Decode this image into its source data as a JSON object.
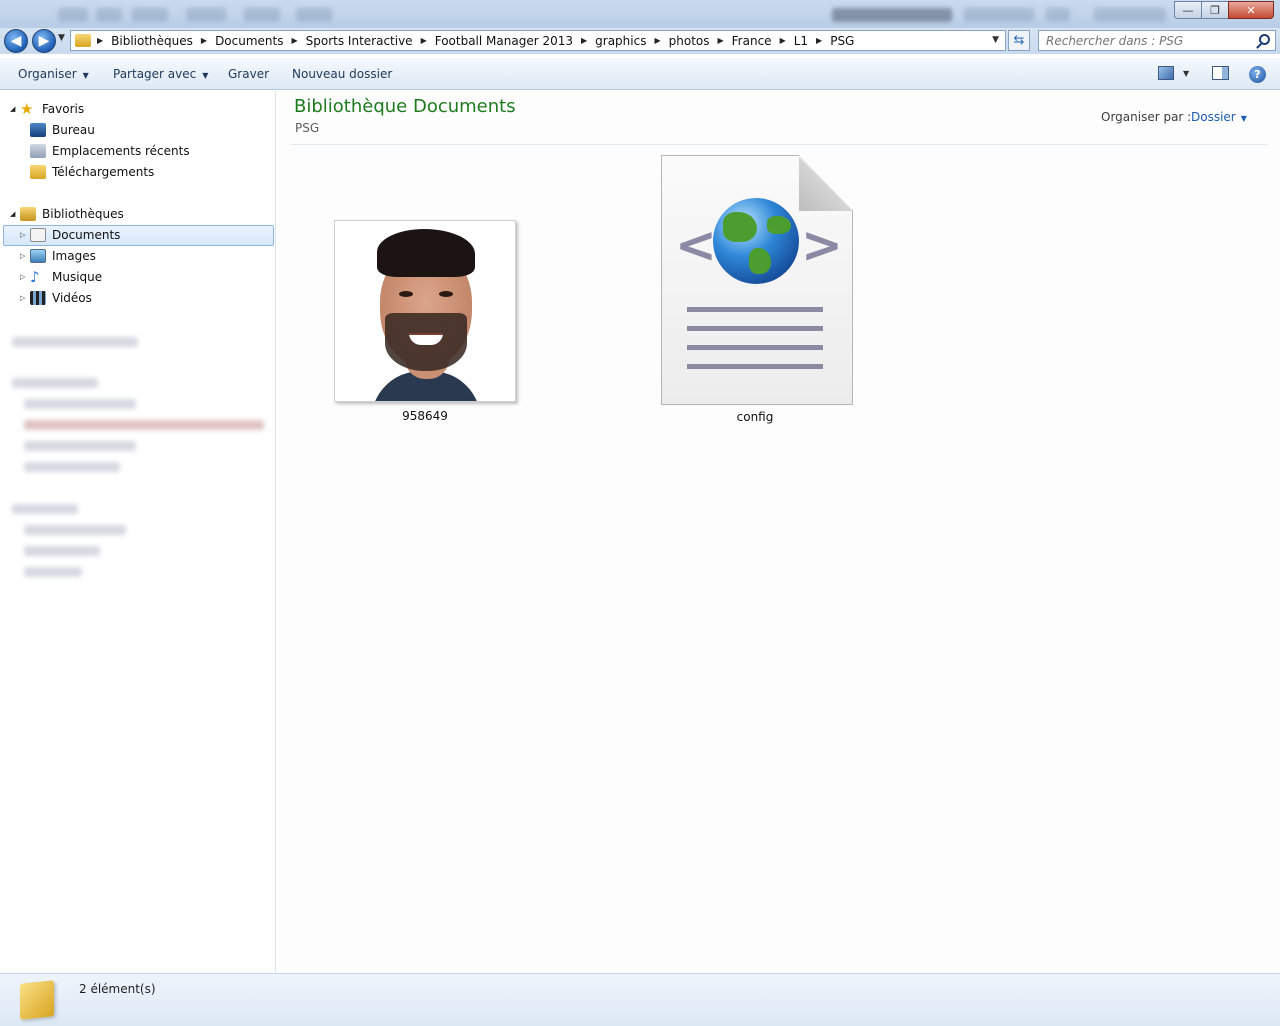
{
  "window": {
    "controls": {
      "minimize": "—",
      "maximize": "❐",
      "close": "✕"
    }
  },
  "address": {
    "back": "◀",
    "forward": "▶",
    "crumbs": [
      "Bibliothèques",
      "Documents",
      "Sports Interactive",
      "Football Manager 2013",
      "graphics",
      "photos",
      "France",
      "L1",
      "PSG"
    ],
    "search_placeholder": "Rechercher dans : PSG"
  },
  "toolbar": {
    "organize": "Organiser",
    "share": "Partager avec",
    "burn": "Graver",
    "new_folder": "Nouveau dossier",
    "help": "?"
  },
  "nav": {
    "favorites": {
      "label": "Favoris",
      "items": [
        "Bureau",
        "Emplacements récents",
        "Téléchargements"
      ]
    },
    "libraries": {
      "label": "Bibliothèques",
      "items": [
        "Documents",
        "Images",
        "Musique",
        "Vidéos"
      ]
    }
  },
  "content": {
    "title": "Bibliothèque Documents",
    "subtitle": "PSG",
    "arrange_label": "Organiser par :",
    "arrange_value": "Dossier",
    "files": [
      {
        "name": "958649",
        "type": "image"
      },
      {
        "name": "config",
        "type": "xml"
      }
    ]
  },
  "status": {
    "count": "2 élément(s)"
  },
  "colors": {
    "title_green": "#1e7a1e",
    "link_blue": "#1c5db0",
    "selection": "#d6e8fb"
  }
}
